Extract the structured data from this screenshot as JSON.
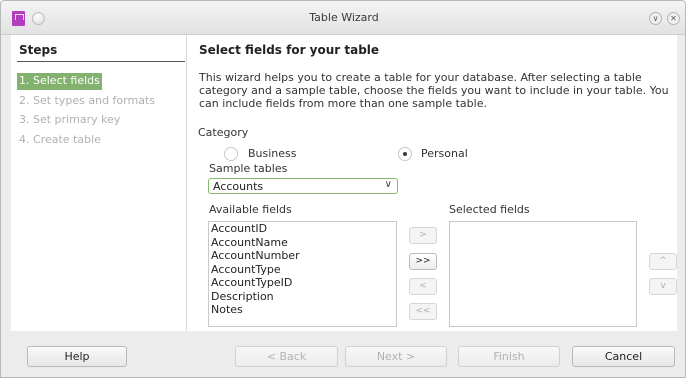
{
  "window": {
    "title": "Table Wizard"
  },
  "steps": {
    "title": "Steps",
    "items": [
      {
        "label": "1. Select fields",
        "active": true
      },
      {
        "label": "2. Set types and formats",
        "active": false
      },
      {
        "label": "3. Set primary key",
        "active": false
      },
      {
        "label": "4. Create table",
        "active": false
      }
    ]
  },
  "main": {
    "heading": "Select fields for your table",
    "description": "This wizard helps you to create a table for your database. After selecting a table category and a sample table, choose the fields you want to include in your table. You can include fields from more than one sample table.",
    "category_label": "Category",
    "category_options": [
      {
        "label": "Business",
        "selected": false
      },
      {
        "label": "Personal",
        "selected": true
      }
    ],
    "sample_tables_label": "Sample tables",
    "sample_table_value": "Accounts",
    "available_fields_label": "Available fields",
    "available_fields": [
      "AccountID",
      "AccountName",
      "AccountNumber",
      "AccountType",
      "AccountTypeID",
      "Description",
      "Notes"
    ],
    "selected_fields_label": "Selected fields",
    "selected_fields": [],
    "move_buttons": {
      "add_one": ">",
      "add_all": ">>",
      "remove_one": "<",
      "remove_all": "<<"
    },
    "order_buttons": {
      "up": "^",
      "down": "v"
    }
  },
  "footer": {
    "help": "Help",
    "back": "< Back",
    "next": "Next >",
    "finish": "Finish",
    "cancel": "Cancel"
  },
  "colors": {
    "accent_green": "#83b16e",
    "app_icon": "#b13fbd"
  }
}
